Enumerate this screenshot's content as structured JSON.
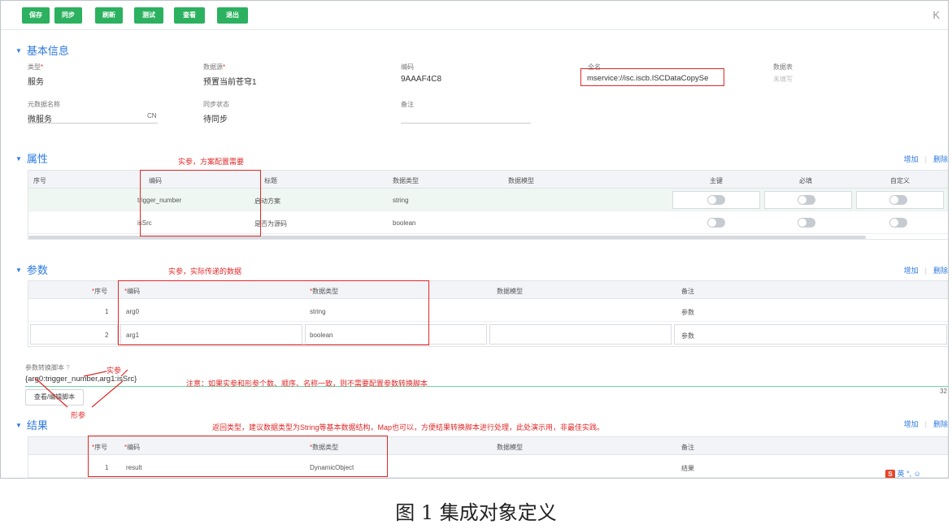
{
  "toolbar": {
    "buttons": [
      "保存",
      "同步",
      "刷新",
      "测试",
      "查看",
      "退出"
    ],
    "collapse": "K"
  },
  "basic": {
    "title": "基本信息",
    "type_label": "类型",
    "type_value": "服务",
    "source_label": "数据源",
    "source_value": "预置当前苍穹1",
    "code_label": "编码",
    "code_value": "9AAAF4C8",
    "fullname_label": "全名",
    "fullname_value": "mservice://isc.iscb.ISCDataCopySe",
    "datatable_label": "数据表",
    "datatable_value": "未填写",
    "meta_name_label": "元数据名称",
    "meta_name_value": "微服务",
    "meta_lang": "CN",
    "sync_label": "同步状态",
    "sync_value": "待同步",
    "remark_label": "备注"
  },
  "props": {
    "title": "属性",
    "add": "增加",
    "delete": "删除",
    "note": "实参，方案配置需要",
    "headers": [
      "序号",
      "编码",
      "标题",
      "数据类型",
      "数据模型",
      "主键",
      "必填",
      "自定义"
    ],
    "rows": [
      {
        "code": "trigger_number",
        "title": "启动方案",
        "dtype": "string"
      },
      {
        "code": "isSrc",
        "title": "是否为源码",
        "dtype": "boolean"
      }
    ]
  },
  "params": {
    "title": "参数",
    "add": "增加",
    "delete": "删除",
    "note": "实参，实际传递的数据",
    "headers": [
      "序号",
      "编码",
      "数据类型",
      "数据模型",
      "备注"
    ],
    "rows": [
      {
        "idx": "1",
        "code": "arg0",
        "dtype": "string",
        "remark": "参数"
      },
      {
        "idx": "2",
        "code": "arg1",
        "dtype": "boolean",
        "remark": "参数"
      }
    ]
  },
  "script": {
    "label": "参数转换脚本",
    "help": "?",
    "value": "{arg0:trigger_number,arg1:isSrc}",
    "button": "查看/编辑脚本",
    "counter": "32",
    "actual_label": "实参",
    "formal_label": "形参",
    "note": "注意：如果实参和形参个数、顺序、名称一致，则不需要配置参数转换脚本"
  },
  "result": {
    "title": "结果",
    "add": "增加",
    "delete": "删除",
    "note": "返回类型，建议数据类型为String等基本数据结构，Map也可以，方便结果转换脚本进行处理，此处演示用，非最佳实践。",
    "headers": [
      "序号",
      "编码",
      "数据类型",
      "数据模型",
      "备注"
    ],
    "rows": [
      {
        "idx": "1",
        "code": "result",
        "dtype": "DynamicObject",
        "remark": "结果"
      }
    ]
  },
  "ime": {
    "label": "英"
  },
  "caption": "图 1  集成对象定义"
}
